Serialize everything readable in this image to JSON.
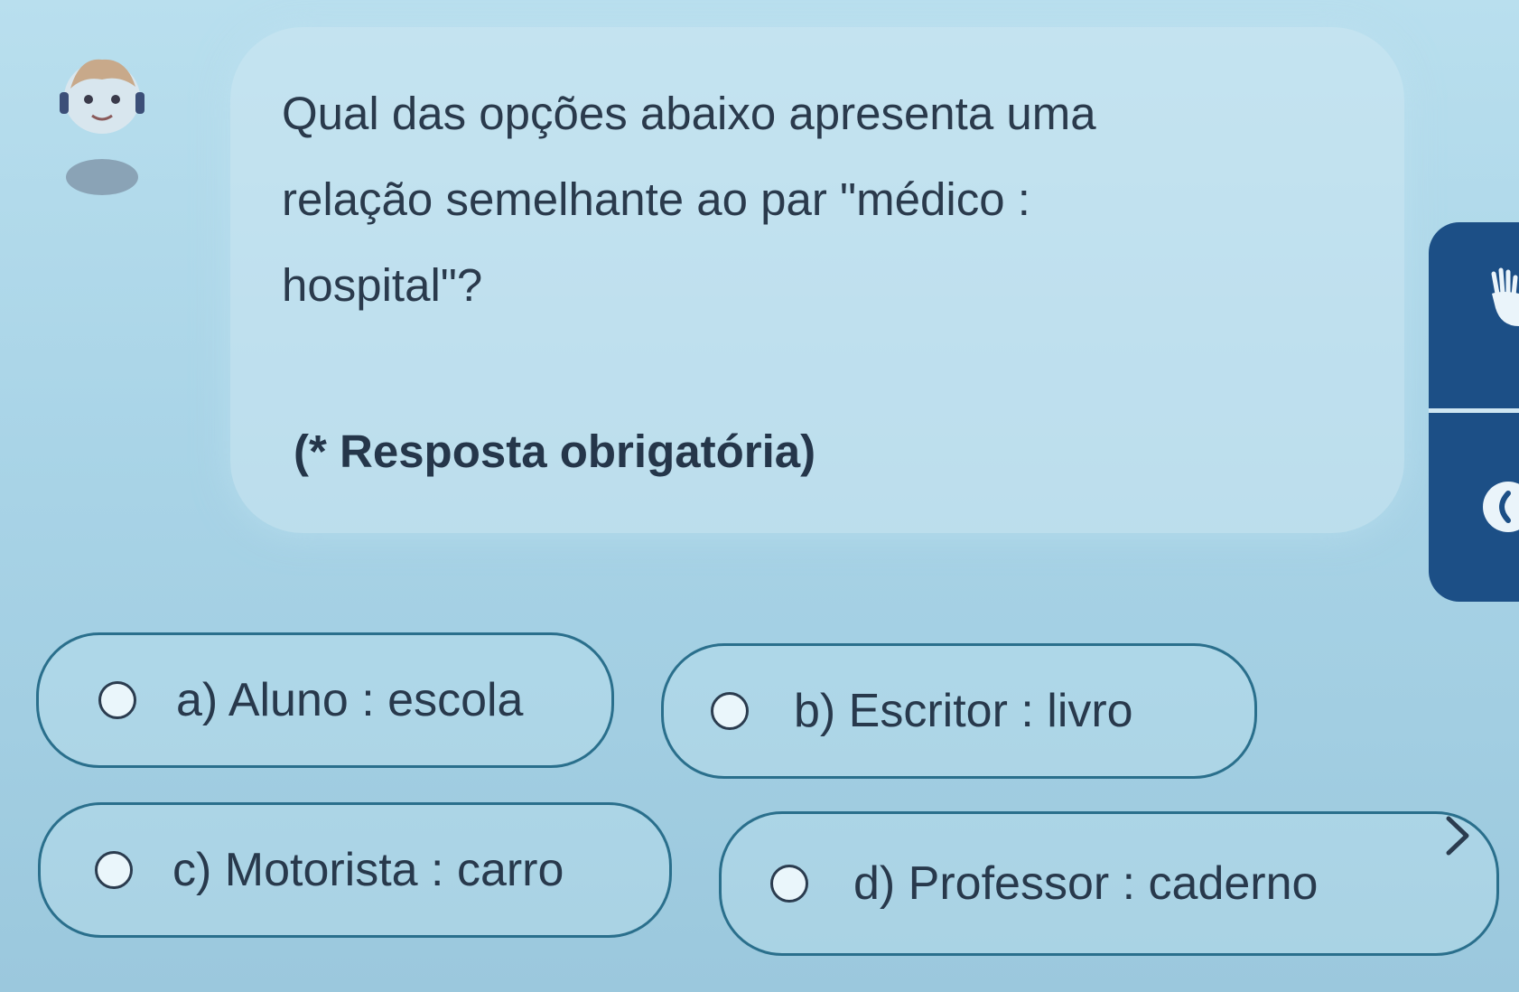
{
  "question": {
    "text": "Qual das opções abaixo apresenta uma\nrelação semelhante ao par \"médico :\nhospital\"?",
    "required_note": "(* Resposta obrigatória)"
  },
  "options": [
    {
      "id": "a",
      "label": "a) Aluno : escola",
      "selected": false
    },
    {
      "id": "b",
      "label": "b) Escritor : livro",
      "selected": false
    },
    {
      "id": "c",
      "label": "c) Motorista : carro",
      "selected": false
    },
    {
      "id": "d",
      "label": "d) Professor : caderno",
      "selected": false
    }
  ],
  "icons": {
    "avatar": "character-avatar-icon",
    "side_top": "hand-icon",
    "side_bottom": "circle-arrow-icon",
    "next": "chevron-right-icon"
  },
  "colors": {
    "background": "#b9dfee",
    "side_panel": "#1c4f86",
    "option_border": "#2a6f8c",
    "text": "#2a3a4c"
  }
}
